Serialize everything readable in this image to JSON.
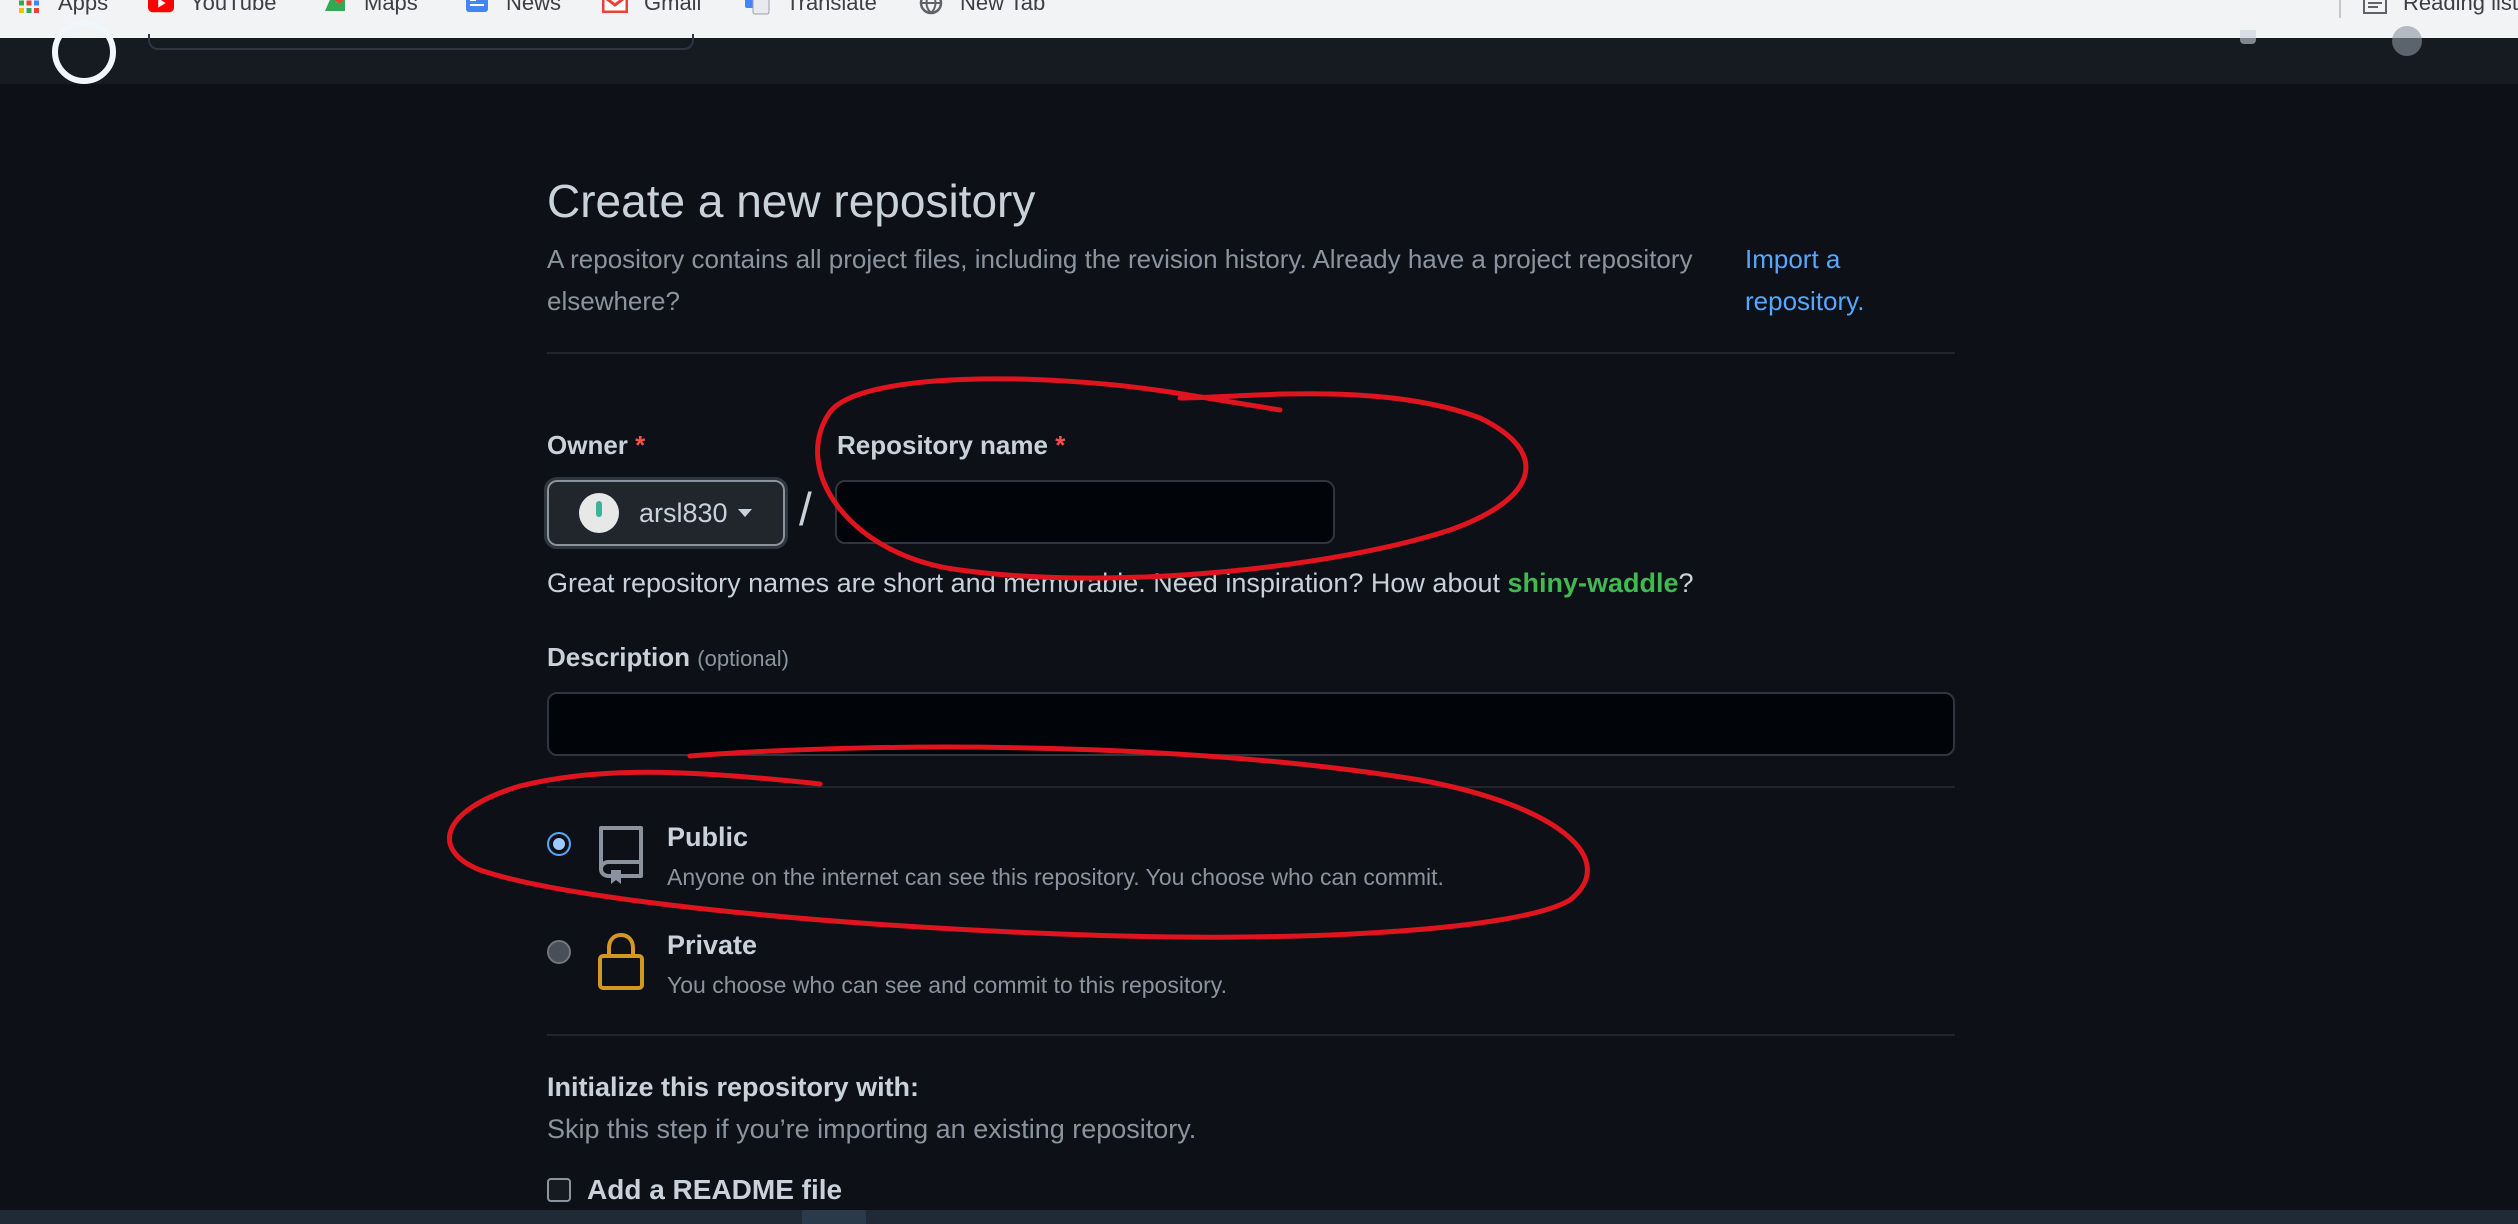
{
  "bookmarks": [
    {
      "label": "Apps",
      "icon": "apps-grid-icon"
    },
    {
      "label": "YouTube",
      "icon": "youtube-icon"
    },
    {
      "label": "Maps",
      "icon": "maps-icon"
    },
    {
      "label": "News",
      "icon": "news-icon"
    },
    {
      "label": "Gmail",
      "icon": "gmail-icon"
    },
    {
      "label": "Translate",
      "icon": "translate-icon"
    },
    {
      "label": "New Tab",
      "icon": "globe-icon"
    }
  ],
  "reading_list": "Reading list",
  "page": {
    "title": "Create a new repository",
    "subtitle": "A repository contains all project files, including the revision history. Already have a project repository elsewhere?",
    "import_link": "Import a repository."
  },
  "owner": {
    "label": "Owner",
    "required_mark": "*",
    "value": "arsl830"
  },
  "separator": "/",
  "repo_name": {
    "label": "Repository name",
    "required_mark": "*",
    "value": ""
  },
  "hint": {
    "prefix": "Great repository names are short and memorable. Need inspiration? How about ",
    "suggestion": "shiny-waddle",
    "suffix": "?"
  },
  "description": {
    "label": "Description",
    "optional": "(optional)",
    "value": ""
  },
  "visibility": {
    "selected": "public",
    "public": {
      "title": "Public",
      "desc": "Anyone on the internet can see this repository. You choose who can commit."
    },
    "private": {
      "title": "Private",
      "desc": "You choose who can see and commit to this repository."
    }
  },
  "init": {
    "title": "Initialize this repository with:",
    "subtitle": "Skip this step if you’re importing an existing repository.",
    "readme_label": "Add a README file"
  },
  "colors": {
    "accent_link": "#58a6ff",
    "suggestion_green": "#3fb950",
    "required_red": "#f85149",
    "annotation_red": "#e0141e",
    "lock_icon": "#d29922"
  }
}
